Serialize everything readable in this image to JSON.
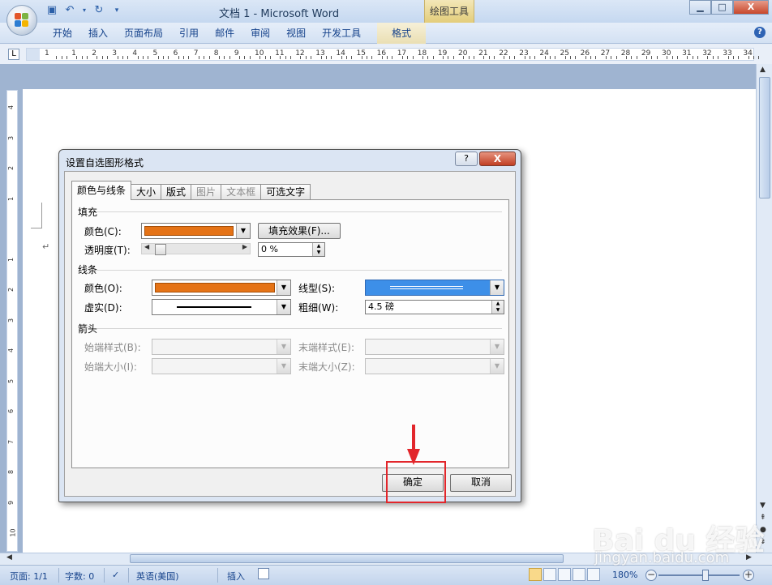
{
  "window": {
    "title": "文档 1 - Microsoft Word",
    "context_tab_group": "绘图工具",
    "controls": {
      "minimize": "▁",
      "maximize": "□",
      "close": "X"
    }
  },
  "quick_access": {
    "save_icon": "save-icon",
    "undo_icon": "undo-icon",
    "redo_icon": "redo-icon"
  },
  "ribbon": {
    "tabs": [
      "开始",
      "插入",
      "页面布局",
      "引用",
      "邮件",
      "审阅",
      "视图",
      "开发工具",
      "格式"
    ],
    "help": "?"
  },
  "ruler": {
    "corner": "L",
    "h_numbers": [
      "1",
      "1",
      "2",
      "3",
      "4",
      "5",
      "6",
      "7",
      "8",
      "9",
      "10",
      "11",
      "12",
      "13",
      "14",
      "15",
      "16",
      "17",
      "18",
      "19",
      "20",
      "21",
      "22",
      "23",
      "24",
      "25",
      "26",
      "27",
      "28",
      "29",
      "30",
      "31",
      "32",
      "33",
      "34"
    ],
    "v_numbers": [
      "4",
      "3",
      "2",
      "1",
      "",
      "1",
      "2",
      "3",
      "4",
      "5",
      "6",
      "7",
      "8",
      "9",
      "10"
    ]
  },
  "document": {
    "paragraph_mark": "↵"
  },
  "dialog": {
    "title": "设置自选图形格式",
    "help": "?",
    "close": "X",
    "tabs": [
      {
        "label": "颜色与线条",
        "state": "active"
      },
      {
        "label": "大小",
        "state": "normal"
      },
      {
        "label": "版式",
        "state": "normal"
      },
      {
        "label": "图片",
        "state": "disabled"
      },
      {
        "label": "文本框",
        "state": "disabled"
      },
      {
        "label": "可选文字",
        "state": "normal"
      }
    ],
    "fill": {
      "section": "填充",
      "color_label": "颜色(C):",
      "color_value": "#e57316",
      "effects_button": "填充效果(F)...",
      "transparency_label": "透明度(T):",
      "transparency_value": "0 %"
    },
    "line": {
      "section": "线条",
      "color_label": "颜色(O):",
      "color_value": "#e57316",
      "style_label": "线型(S):",
      "dash_label": "虚实(D):",
      "weight_label": "粗细(W):",
      "weight_value": "4.5 磅"
    },
    "arrows": {
      "section": "箭头",
      "begin_style": "始端样式(B):",
      "end_style": "末端样式(E):",
      "begin_size": "始端大小(I):",
      "end_size": "末端大小(Z):"
    },
    "ok": "确定",
    "cancel": "取消"
  },
  "statusbar": {
    "page": "页面: 1/1",
    "words": "字数: 0",
    "language": "英语(美国)",
    "mode": "插入",
    "zoom": "180%"
  },
  "watermark": {
    "logo": "Bai du 经验",
    "url": "jingyan.baidu.com"
  },
  "colors": {
    "accent_orange": "#e57316",
    "selection_blue": "#3d8fe8",
    "highlight_red": "#e2262b"
  }
}
